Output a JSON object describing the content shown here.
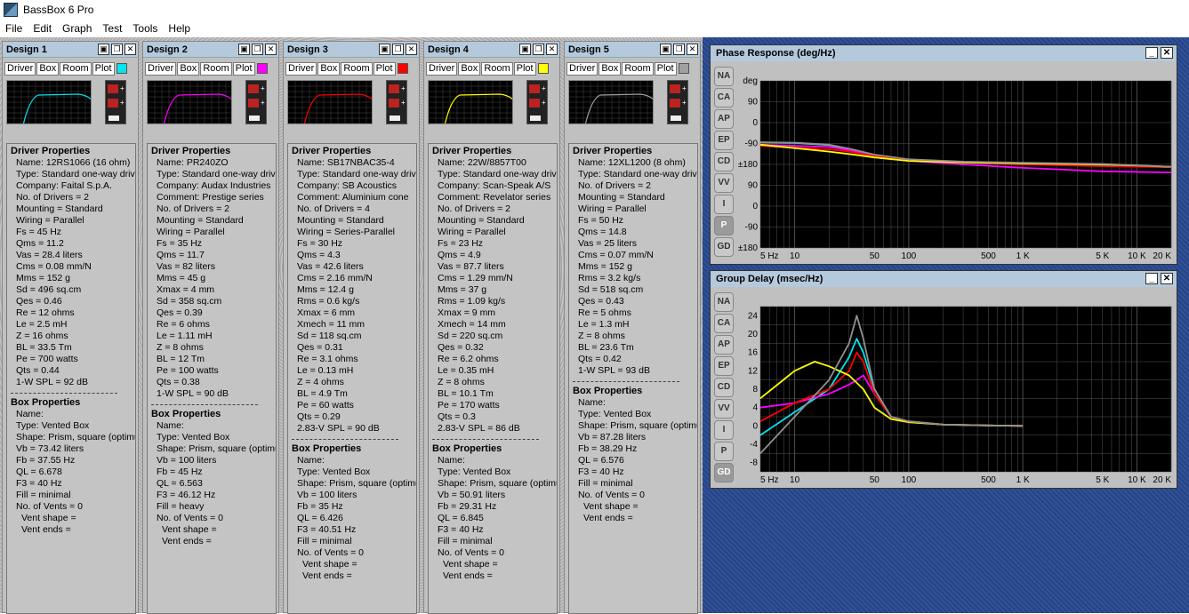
{
  "app": {
    "title": "BassBox 6 Pro"
  },
  "menu": [
    "File",
    "Edit",
    "Graph",
    "Test",
    "Tools",
    "Help"
  ],
  "design_tabs": [
    "Driver",
    "Box",
    "Room",
    "Plot"
  ],
  "designs": [
    {
      "title": "Design 1",
      "color": "#00e5ee",
      "driver_header": "Driver Properties",
      "driver_lines": [
        "Name: 12RS1066 (16 ohm)",
        "Type: Standard one-way driver",
        "Company: Faital S.p.A.",
        "No. of Drivers = 2",
        "Mounting = Standard",
        "Wiring = Parallel",
        "Fs = 45 Hz",
        "Qms = 11.2",
        "Vas = 28.4 liters",
        "Cms = 0.08 mm/N",
        "Mms = 152 g",
        "Sd = 496 sq.cm",
        "Qes = 0.46",
        "Re = 12 ohms",
        "Le = 2.5 mH",
        "Z = 16 ohms",
        "BL = 33.5 Tm",
        "Pe = 700 watts",
        "Qts = 0.44",
        "1-W SPL = 92 dB"
      ],
      "box_header": "Box Properties",
      "box_lines": [
        "Name:",
        "Type: Vented Box",
        "Shape: Prism, square (optimum)",
        "Vb = 73.42 liters",
        "Fb = 37.55 Hz",
        "QL = 6.678",
        "F3 = 40 Hz",
        "Fill = minimal",
        "No. of Vents = 0"
      ],
      "vent_lines": [
        "Vent shape =",
        "Vent ends ="
      ]
    },
    {
      "title": "Design 2",
      "color": "#ff00ff",
      "driver_header": "Driver Properties",
      "driver_lines": [
        "Name: PR240ZO",
        "Type: Standard one-way driver",
        "Company: Audax Industries",
        "Comment: Prestige series",
        "No. of Drivers = 2",
        "Mounting = Standard",
        "Wiring = Parallel",
        "Fs = 35 Hz",
        "Qms = 11.7",
        "Vas = 82 liters",
        "Mms = 45 g",
        "Xmax = 4 mm",
        "Sd = 358 sq.cm",
        "Qes = 0.39",
        "Re = 6 ohms",
        "Le = 1.11 mH",
        "Z = 8 ohms",
        "BL = 12 Tm",
        "Pe = 100 watts",
        "Qts = 0.38",
        "1-W SPL = 90 dB"
      ],
      "box_header": "Box Properties",
      "box_lines": [
        "Name:",
        "Type: Vented Box",
        "Shape: Prism, square (optimum)",
        "Vb = 100 liters",
        "Fb = 45 Hz",
        "QL = 6.563",
        "F3 = 46.12 Hz",
        "Fill = heavy",
        "No. of Vents = 0"
      ],
      "vent_lines": [
        "Vent shape =",
        "Vent ends ="
      ]
    },
    {
      "title": "Design 3",
      "color": "#ff0000",
      "driver_header": "Driver Properties",
      "driver_lines": [
        "Name: SB17NBAC35-4",
        "Type: Standard one-way driver",
        "Company: SB Acoustics",
        "Comment: Aluminium cone",
        "No. of Drivers = 4",
        "Mounting = Standard",
        "Wiring = Series-Parallel",
        "Fs = 30 Hz",
        "Qms = 4.3",
        "Vas = 42.6 liters",
        "Cms = 2.16 mm/N",
        "Mms = 12.4 g",
        "Rms = 0.6 kg/s",
        "Xmax = 6 mm",
        "Xmech = 11 mm",
        "Sd = 118 sq.cm",
        "Qes = 0.31",
        "Re = 3.1 ohms",
        "Le = 0.13 mH",
        "Z = 4 ohms",
        "BL = 4.9 Tm",
        "Pe = 60 watts",
        "Qts = 0.29",
        "2.83-V SPL = 90 dB"
      ],
      "box_header": "Box Properties",
      "box_lines": [
        "Name:",
        "Type: Vented Box",
        "Shape: Prism, square (optimum)",
        "Vb = 100 liters",
        "Fb = 35 Hz",
        "QL = 6.426",
        "F3 = 40.51 Hz",
        "Fill = minimal",
        "No. of Vents = 0"
      ],
      "vent_lines": [
        "Vent shape =",
        "Vent ends ="
      ]
    },
    {
      "title": "Design 4",
      "color": "#ffff00",
      "driver_header": "Driver Properties",
      "driver_lines": [
        "Name: 22W/8857T00",
        "Type: Standard one-way driver",
        "Company: Scan-Speak A/S",
        "Comment: Revelator series",
        "No. of Drivers = 2",
        "Mounting = Standard",
        "Wiring = Parallel",
        "Fs = 23 Hz",
        "Qms = 4.9",
        "Vas = 87.7 liters",
        "Cms = 1.29 mm/N",
        "Mms = 37 g",
        "Rms = 1.09 kg/s",
        "Xmax = 9 mm",
        "Xmech = 14 mm",
        "Sd = 220 sq.cm",
        "Qes = 0.32",
        "Re = 6.2 ohms",
        "Le = 0.35 mH",
        "Z = 8 ohms",
        "BL = 10.1 Tm",
        "Pe = 170 watts",
        "Qts = 0.3",
        "2.83-V SPL = 86 dB"
      ],
      "box_header": "Box Properties",
      "box_lines": [
        "Name:",
        "Type: Vented Box",
        "Shape: Prism, square (optimum)",
        "Vb = 50.91 liters",
        "Fb = 29.31 Hz",
        "QL = 6.845",
        "F3 = 40 Hz",
        "Fill = minimal",
        "No. of Vents = 0"
      ],
      "vent_lines": [
        "Vent shape =",
        "Vent ends ="
      ]
    },
    {
      "title": "Design 5",
      "color": "#a0a0a0",
      "driver_header": "Driver Properties",
      "driver_lines": [
        "Name: 12XL1200 (8 ohm)",
        "Type: Standard one-way driver",
        "No. of Drivers = 2",
        "Mounting = Standard",
        "Wiring = Parallel",
        "Fs = 50 Hz",
        "Qms = 14.8",
        "Vas = 25 liters",
        "Cms = 0.07 mm/N",
        "Mms = 152 g",
        "Rms = 3.2 kg/s",
        "Sd = 518 sq.cm",
        "Qes = 0.43",
        "Re = 5 ohms",
        "Le = 1.3 mH",
        "Z = 8 ohms",
        "BL = 23.6 Tm",
        "Qts = 0.42",
        "1-W SPL = 93 dB"
      ],
      "box_header": "Box Properties",
      "box_lines": [
        "Name:",
        "Type: Vented Box",
        "Shape: Prism, square (optimum)",
        "Vb = 87.28 liters",
        "Fb = 38.29 Hz",
        "QL = 6.576",
        "F3 = 40 Hz",
        "Fill = minimal",
        "No. of Vents = 0"
      ],
      "vent_lines": [
        "Vent shape =",
        "Vent ends ="
      ]
    }
  ],
  "side_buttons": [
    "NA",
    "CA",
    "AP",
    "EP",
    "CD",
    "VV",
    "I",
    "P",
    "GD"
  ],
  "plots": {
    "phase": {
      "title": "Phase Response (deg/Hz)",
      "active": "P",
      "unit": "deg"
    },
    "group": {
      "title": "Group Delay (msec/Hz)",
      "active": "GD",
      "unit": "msec"
    }
  },
  "chart_data": [
    {
      "type": "line",
      "title": "Phase Response (deg/Hz)",
      "xscale": "log",
      "xlim": [
        5,
        20000
      ],
      "x_ticks": [
        "5 Hz",
        "10",
        "50",
        "100",
        "500",
        "1 K",
        "5 K",
        "10 K",
        "20 K"
      ],
      "y_ticks": [
        "deg",
        "90",
        "0",
        "-90",
        "±180",
        "90",
        "0",
        "-90",
        "±180"
      ],
      "series": [
        {
          "color": "#40c8c8",
          "x": [
            5,
            10,
            20,
            30,
            50,
            100,
            300,
            1000,
            5000,
            20000
          ],
          "y": [
            -85,
            -88,
            -97,
            -115,
            -140,
            -160,
            -170,
            -175,
            -185,
            -192
          ]
        },
        {
          "color": "#ff00ff",
          "x": [
            5,
            10,
            20,
            30,
            50,
            100,
            300,
            1000,
            5000,
            20000
          ],
          "y": [
            -95,
            -100,
            -105,
            -118,
            -145,
            -165,
            -180,
            -195,
            -210,
            -215
          ]
        },
        {
          "color": "#ff0000",
          "x": [
            5,
            10,
            20,
            30,
            50,
            100,
            300,
            1000,
            5000,
            20000
          ],
          "y": [
            -100,
            -108,
            -115,
            -125,
            -145,
            -162,
            -172,
            -180,
            -188,
            -192
          ]
        },
        {
          "color": "#ffff00",
          "x": [
            5,
            10,
            20,
            30,
            50,
            100,
            300,
            1000,
            5000,
            20000
          ],
          "y": [
            -95,
            -110,
            -125,
            -135,
            -150,
            -165,
            -172,
            -176,
            -180,
            -190
          ]
        },
        {
          "color": "#909090",
          "x": [
            5,
            10,
            20,
            30,
            50,
            100,
            300,
            1000,
            5000,
            20000
          ],
          "y": [
            -85,
            -86,
            -95,
            -112,
            -138,
            -158,
            -168,
            -173,
            -178,
            -190
          ]
        }
      ]
    },
    {
      "type": "line",
      "title": "Group Delay (msec/Hz)",
      "xscale": "log",
      "xlim": [
        5,
        20000
      ],
      "ylim": [
        -8,
        26
      ],
      "x_ticks": [
        "5 Hz",
        "10",
        "50",
        "100",
        "500",
        "1 K",
        "5 K",
        "10 K",
        "20 K"
      ],
      "y_ticks": [
        "24",
        "20",
        "16",
        "12",
        "8",
        "4",
        "0",
        "-4",
        "-8"
      ],
      "series": [
        {
          "color": "#00e5ee",
          "x": [
            5,
            10,
            20,
            30,
            35,
            40,
            50,
            70,
            100,
            200,
            500,
            1000
          ],
          "y": [
            -2,
            3,
            8,
            15,
            19,
            16,
            8,
            2,
            1,
            0.3,
            0.1,
            0
          ]
        },
        {
          "color": "#ff00ff",
          "x": [
            5,
            10,
            20,
            30,
            35,
            40,
            50,
            70,
            100,
            200,
            500,
            1000
          ],
          "y": [
            4,
            5,
            7,
            9,
            10,
            11,
            7,
            2,
            1,
            0.3,
            0.1,
            0
          ]
        },
        {
          "color": "#ff0000",
          "x": [
            5,
            10,
            20,
            30,
            35,
            40,
            50,
            70,
            100,
            200,
            500,
            1000
          ],
          "y": [
            1,
            5,
            8,
            12,
            16,
            14,
            7,
            2,
            1,
            0.3,
            0.1,
            0
          ]
        },
        {
          "color": "#ffff00",
          "x": [
            5,
            10,
            15,
            20,
            30,
            40,
            50,
            70,
            100,
            200,
            500,
            1000
          ],
          "y": [
            6,
            12,
            14,
            13,
            11,
            8,
            4,
            1.5,
            0.8,
            0.3,
            0.1,
            0
          ]
        },
        {
          "color": "#909090",
          "x": [
            5,
            10,
            20,
            30,
            35,
            40,
            50,
            70,
            100,
            200,
            500,
            1000
          ],
          "y": [
            -6,
            2,
            10,
            18,
            24,
            19,
            8,
            2,
            1,
            0.3,
            0.1,
            0
          ]
        }
      ]
    }
  ]
}
